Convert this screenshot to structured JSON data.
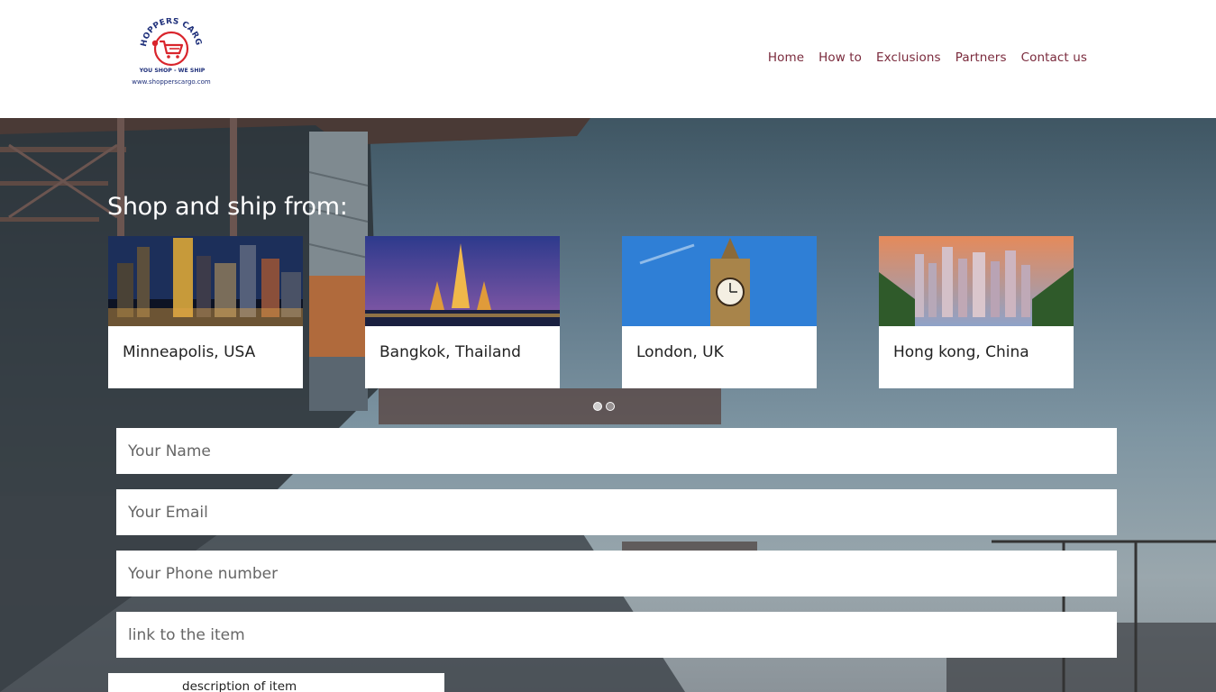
{
  "brand": {
    "name": "SHOPPERS CARGO",
    "tagline": "YOU SHOP - WE SHIP",
    "url": "www.shopperscargo.com"
  },
  "nav": {
    "items": [
      {
        "label": "Home"
      },
      {
        "label": "How to"
      },
      {
        "label": "Exclusions"
      },
      {
        "label": "Partners"
      },
      {
        "label": "Contact us"
      }
    ]
  },
  "hero": {
    "title": "Shop and ship from:",
    "cities": [
      {
        "name": "Minneapolis, USA",
        "image": "minneapolis-skyline-night"
      },
      {
        "name": "Bangkok, Thailand",
        "image": "wat-arun-temple-dusk"
      },
      {
        "name": "London, UK",
        "image": "big-ben-blue-sky"
      },
      {
        "name": "Hong kong, China",
        "image": "hong-kong-skyline-sunset"
      }
    ],
    "carousel": {
      "pages": 2,
      "active": 1
    }
  },
  "form": {
    "name_placeholder": "Your Name",
    "email_placeholder": "Your Email",
    "phone_placeholder": "Your Phone number",
    "link_placeholder": "link to the item",
    "description_label": "description of item"
  },
  "colors": {
    "nav_text": "#7a2a3c",
    "logo_red": "#d9252c",
    "logo_blue": "#1e2f7a",
    "hero_title": "#ffffff"
  }
}
